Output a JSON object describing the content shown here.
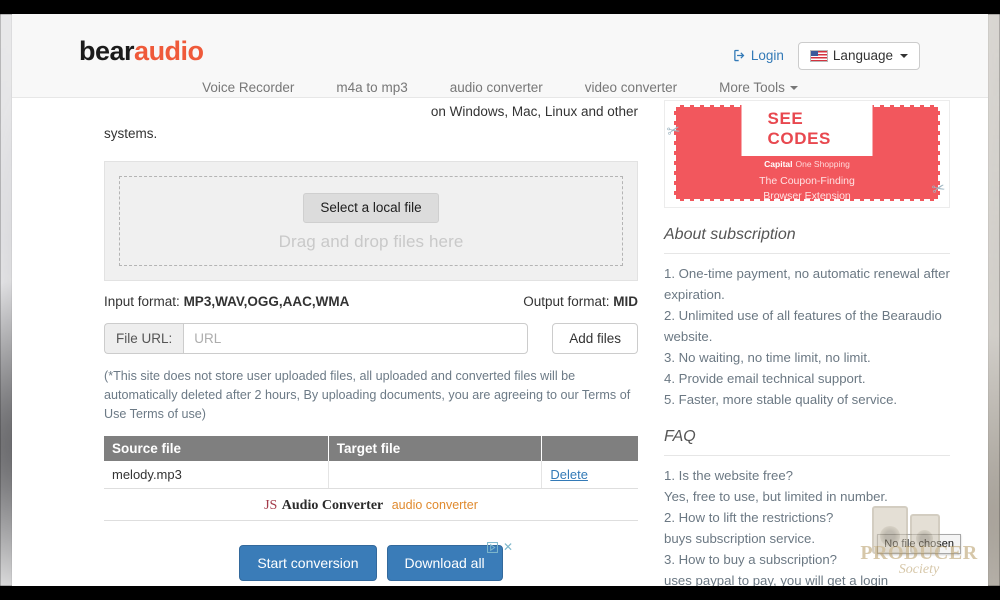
{
  "header": {
    "logo_bear": "bear",
    "logo_audio": "audio",
    "login_label": "Login",
    "language_label": "Language",
    "nav": [
      {
        "label": "Voice Recorder"
      },
      {
        "label": "m4a to mp3"
      },
      {
        "label": "audio converter"
      },
      {
        "label": "video converter"
      },
      {
        "label": "More Tools"
      }
    ]
  },
  "main": {
    "intro_line1": "on Windows, Mac, Linux and other",
    "intro_line2": "systems.",
    "select_file_button": "Select a local file",
    "drop_hint": "Drag and drop files here",
    "input_format_label": "Input format:",
    "input_format_value": "MP3,WAV,OGG,AAC,WMA",
    "output_format_label": "Output format:",
    "output_format_value": "MID",
    "url_label": "File URL:",
    "url_value": "",
    "url_placeholder": "URL",
    "add_files_button": "Add files",
    "disclaimer": "(*This site does not store user uploaded files, all uploaded and converted files will be automatically deleted after 2 hours, By uploading documents, you are agreeing to our Terms of Use Terms of use)",
    "table": {
      "columns": [
        "Source file",
        "Target file",
        ""
      ],
      "rows": [
        {
          "source": "melody.mp3",
          "target": "",
          "action": "Delete"
        }
      ]
    },
    "brand": {
      "js": "JS",
      "audio_converter": "Audio Converter",
      "sub": "audio converter"
    },
    "start_conversion_button": "Start conversion",
    "download_all_button": "Download all",
    "ad_close": "✕"
  },
  "sidebar": {
    "ad": {
      "headline": "SEE CODES",
      "brand_1": "Capital",
      "brand_2": "One Shopping",
      "line1": "The Coupon-Finding",
      "line2": "Browser Extension"
    },
    "about": {
      "title": "About subscription",
      "items": [
        "1. One-time payment, no automatic renewal after expiration.",
        "2. Unlimited use of all features of the Bearaudio website.",
        "3. No waiting, no time limit, no limit.",
        "4. Provide email technical support.",
        "5. Faster, more stable quality of service."
      ]
    },
    "faq": {
      "title": "FAQ",
      "items": [
        "1. Is the website free?",
        "Yes, free to use, but limited in number.",
        "2. How to lift the restrictions?",
        "buys subscription service.",
        "3. How to buy a subscription?",
        "uses paypal to pay, you will get a login"
      ]
    }
  },
  "overlay": {
    "file_chosen_tooltip": "No file chosen",
    "watermark_main": "PRODUCER",
    "watermark_sub": "Society"
  },
  "colors": {
    "accent_orange": "#ef5a3a",
    "primary_blue": "#3a7cb8",
    "link_blue": "#337ab7",
    "table_header_gray": "#7f7f7f",
    "coupon_red": "#f2575d"
  }
}
